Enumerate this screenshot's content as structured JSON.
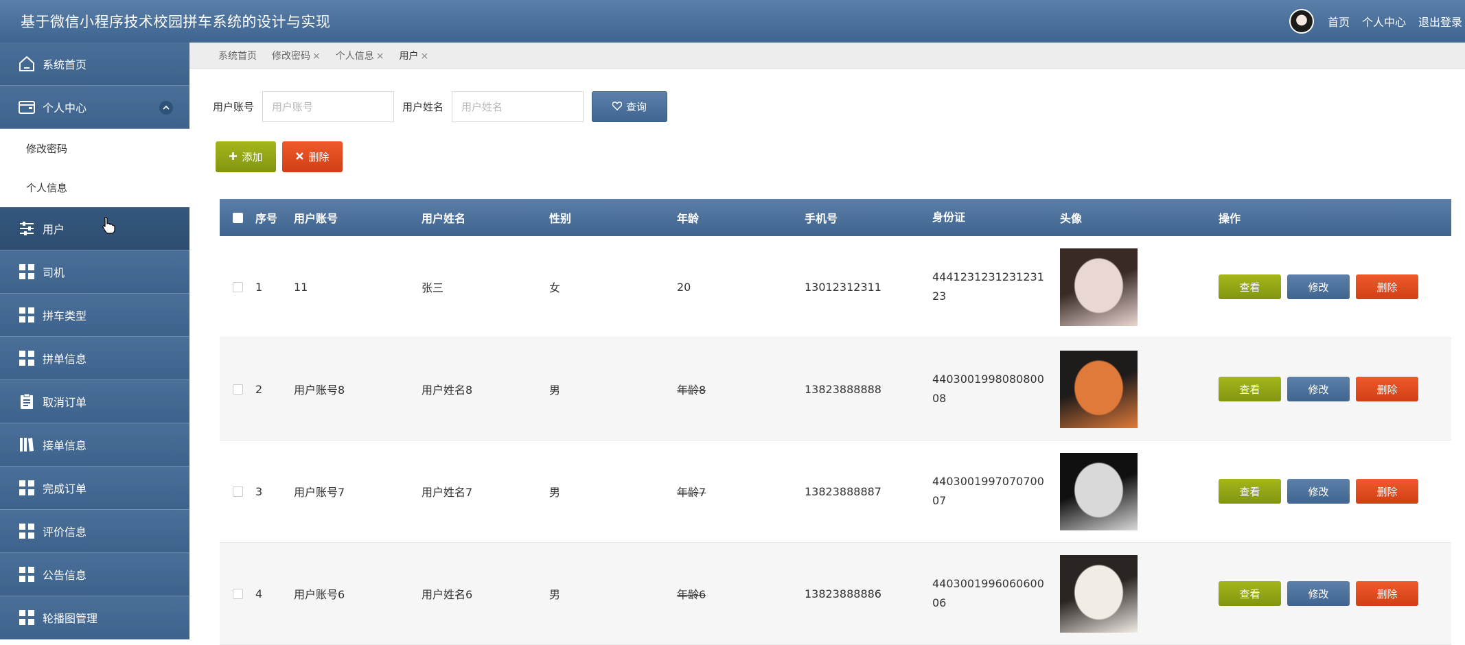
{
  "header": {
    "title": "基于微信小程序技术校园拼车系统的设计与实现",
    "links": [
      "首页",
      "个人中心",
      "退出登录"
    ]
  },
  "sidebar": {
    "home": {
      "label": "系统首页",
      "icon": "home-icon"
    },
    "personal": {
      "label": "个人中心",
      "icon": "wallet-icon"
    },
    "sub_items": [
      "修改密码",
      "个人信息"
    ],
    "items": [
      {
        "label": "用户",
        "icon": "sliders-icon"
      },
      {
        "label": "司机",
        "icon": "grid-icon"
      },
      {
        "label": "拼车类型",
        "icon": "grid-icon"
      },
      {
        "label": "拼单信息",
        "icon": "grid-icon"
      },
      {
        "label": "取消订单",
        "icon": "clipboard-icon"
      },
      {
        "label": "接单信息",
        "icon": "book-icon"
      },
      {
        "label": "完成订单",
        "icon": "grid-icon"
      },
      {
        "label": "评价信息",
        "icon": "grid-icon"
      },
      {
        "label": "公告信息",
        "icon": "grid-icon"
      },
      {
        "label": "轮播图管理",
        "icon": "grid-icon"
      }
    ]
  },
  "tabs": [
    {
      "label": "系统首页",
      "closable": false
    },
    {
      "label": "修改密码",
      "closable": true
    },
    {
      "label": "个人信息",
      "closable": true
    },
    {
      "label": "用户",
      "closable": true
    }
  ],
  "search": {
    "account_label": "用户账号",
    "account_placeholder": "用户账号",
    "name_label": "用户姓名",
    "name_placeholder": "用户姓名",
    "query_label": "查询"
  },
  "actions": {
    "add_label": "添加",
    "delete_label": "删除"
  },
  "table": {
    "headers": [
      "序号",
      "用户账号",
      "用户姓名",
      "性别",
      "年龄",
      "手机号",
      "身份证",
      "头像",
      "操作"
    ],
    "row_buttons": {
      "view": "查看",
      "edit": "修改",
      "delete": "删除"
    },
    "rows": [
      {
        "index": "1",
        "account": "11",
        "name": "张三",
        "gender": "女",
        "age": "20",
        "phone": "13012312311",
        "id_card": "444123123123123123",
        "photo_colors": [
          "#e9d7d2",
          "#3a2a26"
        ]
      },
      {
        "index": "2",
        "account": "用户账号8",
        "name": "用户姓名8",
        "gender": "男",
        "age": "年龄8",
        "phone": "13823888888",
        "id_card": "440300199808080008",
        "photo_colors": [
          "#e07a3a",
          "#1e1b1b"
        ]
      },
      {
        "index": "3",
        "account": "用户账号7",
        "name": "用户姓名7",
        "gender": "男",
        "age": "年龄7",
        "phone": "13823888887",
        "id_card": "440300199707070007",
        "photo_colors": [
          "#d9d9d9",
          "#101010"
        ]
      },
      {
        "index": "4",
        "account": "用户账号6",
        "name": "用户姓名6",
        "gender": "男",
        "age": "年龄6",
        "phone": "13823888886",
        "id_card": "440300199606060006",
        "photo_colors": [
          "#f1ece6",
          "#2a2522"
        ]
      }
    ]
  },
  "colors": {
    "primary": "#3f6590",
    "success": "#839510",
    "danger": "#d13f15"
  }
}
